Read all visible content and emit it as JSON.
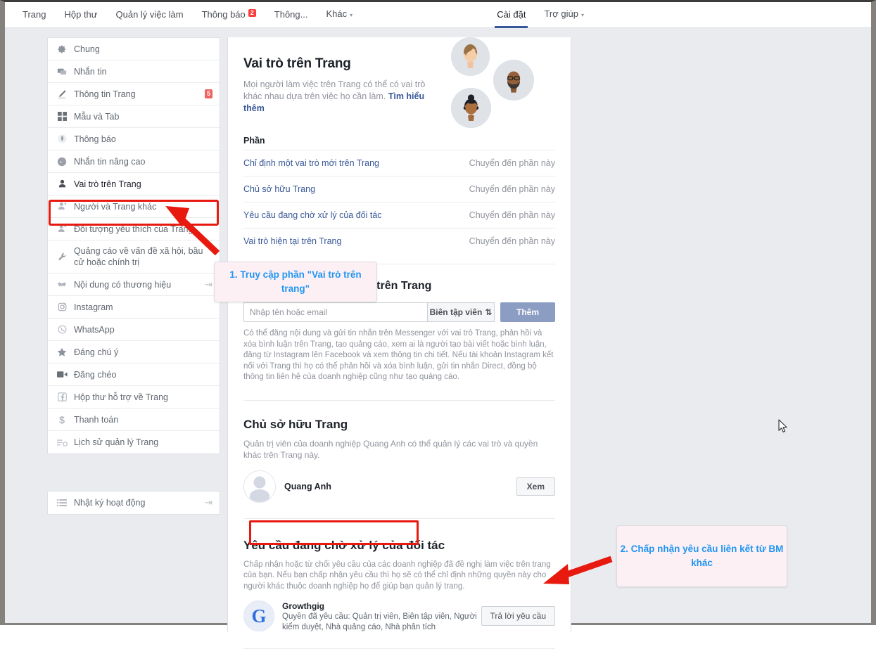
{
  "topnav": {
    "left_items": [
      {
        "label": "Trang",
        "badge": null,
        "caret": false
      },
      {
        "label": "Hộp thư",
        "badge": null,
        "caret": false
      },
      {
        "label": "Quản lý việc làm",
        "badge": null,
        "caret": false
      },
      {
        "label": "Thông báo",
        "badge": "2",
        "caret": false
      },
      {
        "label": "Thông...",
        "badge": null,
        "caret": false
      },
      {
        "label": "Khác",
        "badge": null,
        "caret": true
      }
    ],
    "right_items": [
      {
        "label": "Cài đặt",
        "active": true,
        "caret": false
      },
      {
        "label": "Trợ giúp",
        "active": false,
        "caret": true
      }
    ]
  },
  "sidebar": {
    "items": [
      {
        "label": "Chung",
        "icon": "gear-icon",
        "badge": null,
        "external": false,
        "selected": false
      },
      {
        "label": "Nhắn tin",
        "icon": "chat-icon",
        "badge": null,
        "external": false,
        "selected": false
      },
      {
        "label": "Thông tin Trang",
        "icon": "pencil-icon",
        "badge": "5",
        "external": false,
        "selected": false
      },
      {
        "label": "Mẫu và Tab",
        "icon": "grid-icon",
        "badge": null,
        "external": false,
        "selected": false
      },
      {
        "label": "Thông báo",
        "icon": "globe-icon",
        "badge": null,
        "external": false,
        "selected": false
      },
      {
        "label": "Nhắn tin nâng cao",
        "icon": "bubble-icon",
        "badge": null,
        "external": false,
        "selected": false
      },
      {
        "label": "Vai trò trên Trang",
        "icon": "person-icon",
        "badge": null,
        "external": false,
        "selected": true
      },
      {
        "label": "Người và Trang khác",
        "icon": "person-plus-icon",
        "badge": null,
        "external": false,
        "selected": false
      },
      {
        "label": "Đối tượng yêu thích của Trang",
        "icon": "person-star-icon",
        "badge": null,
        "external": false,
        "selected": false
      },
      {
        "label": "Quảng cáo về vấn đề xã hội, bầu cử hoặc chính trị",
        "icon": "wrench-icon",
        "badge": null,
        "external": false,
        "selected": false
      },
      {
        "label": "Nội dung có thương hiệu",
        "icon": "handshake-icon",
        "badge": null,
        "external": true,
        "selected": false
      },
      {
        "label": "Instagram",
        "icon": "instagram-icon",
        "badge": null,
        "external": false,
        "selected": false
      },
      {
        "label": "WhatsApp",
        "icon": "whatsapp-icon",
        "badge": null,
        "external": false,
        "selected": false
      },
      {
        "label": "Đáng chú ý",
        "icon": "star-icon",
        "badge": null,
        "external": false,
        "selected": false
      },
      {
        "label": "Đăng chéo",
        "icon": "video-icon",
        "badge": null,
        "external": false,
        "selected": false
      },
      {
        "label": "Hộp thư hỗ trợ về Trang",
        "icon": "facebook-icon",
        "badge": null,
        "external": false,
        "selected": false
      },
      {
        "label": "Thanh toán",
        "icon": "dollar-icon",
        "badge": null,
        "external": false,
        "selected": false
      },
      {
        "label": "Lịch sử quản lý Trang",
        "icon": "history-icon",
        "badge": null,
        "external": false,
        "selected": false
      }
    ],
    "secondary_items": [
      {
        "label": "Nhật ký hoạt động",
        "icon": "list-icon",
        "badge": null,
        "external": true,
        "selected": false
      }
    ]
  },
  "hero": {
    "title": "Vai trò trên Trang",
    "description": "Mọi người làm việc trên Trang có thể có vai trò khác nhau dựa trên việc họ cần làm.",
    "learn_more": "Tìm hiểu thêm"
  },
  "sections": {
    "heading": "Phần",
    "jump_label": "Chuyển đến phần này",
    "rows": [
      {
        "label": "Chỉ định một vai trò mới trên Trang"
      },
      {
        "label": "Chủ sở hữu Trang"
      },
      {
        "label": "Yêu cầu đang chờ xử lý của đối tác"
      },
      {
        "label": "Vai trò hiện tại trên Trang"
      }
    ]
  },
  "assign": {
    "heading": "Chỉ định một vai trò mới trên Trang",
    "heading_visible_tail": "Trang",
    "input_placeholder": "Nhập tên hoặc email",
    "input_value": "",
    "role_select": "Biên tập viên",
    "role_select_caret": "⇅",
    "add_button": "Thêm",
    "description": "Có thể đăng nội dung và gửi tin nhắn trên Messenger với vai trò Trang, phản hồi và xóa bình luận trên Trang, tạo quảng cáo, xem ai là người tạo bài viết hoặc bình luận, đăng từ Instagram lên Facebook và xem thông tin chi tiết. Nếu tài khoản Instagram kết nối với Trang thì họ có thể phản hồi và xóa bình luận, gửi tin nhắn Direct, đồng bộ thông tin liên hệ của doanh nghiệp cũng như tạo quảng cáo."
  },
  "owner": {
    "heading": "Chủ sở hữu Trang",
    "description": "Quản trị viên của doanh nghiệp Quang Anh có thể quản lý các vai trò và quyền khác trên Trang này.",
    "name": "Quang Anh",
    "view_button": "Xem"
  },
  "pending": {
    "heading": "Yêu cầu đang chờ xử lý của đối tác",
    "description": "Chấp nhận hoặc từ chối yêu cầu của các doanh nghiệp đã đề nghị làm việc trên trang của bạn. Nếu bạn chấp nhận yêu cầu thì họ sẽ có thể chỉ định những quyền này cho người khác thuộc doanh nghiệp họ để giúp bạn quản lý trang.",
    "partner_name": "Growthgig",
    "partner_logo_letter": "G",
    "partner_permissions": "Quyền đã yêu cầu: Quản trị viên, Biên tập viên, Người kiểm duyệt, Nhà quảng cáo, Nhà phân tích",
    "respond_button": "Trả lời yêu cầu"
  },
  "annotations": {
    "callout1": "1. Truy cập phần \"Vai trò trên trang\"",
    "callout2": "2. Chấp nhận yêu cầu liên kết từ BM khác"
  },
  "colors": {
    "accent_blue": "#385898",
    "highlight_red": "#e8190f",
    "callout_text": "#2196f3",
    "callout_bg": "#fdf0f5",
    "badge_red": "#fa3e3e",
    "page_bg": "#e9ebee"
  }
}
